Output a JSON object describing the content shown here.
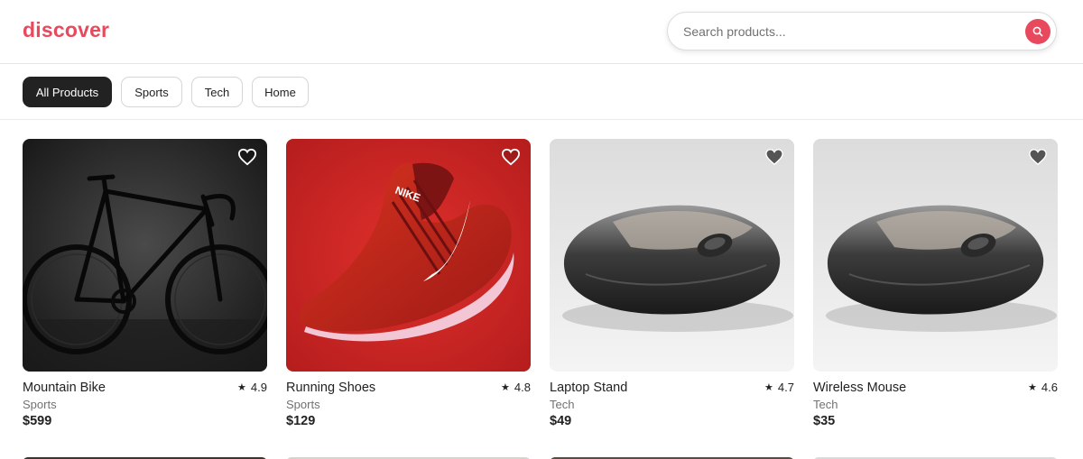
{
  "header": {
    "logo": "discover",
    "search_placeholder": "Search products..."
  },
  "filters": [
    {
      "label": "All Products",
      "active": true
    },
    {
      "label": "Sports",
      "active": false
    },
    {
      "label": "Tech",
      "active": false
    },
    {
      "label": "Home",
      "active": false
    }
  ],
  "products": [
    {
      "name": "Mountain Bike",
      "category": "Sports",
      "price": "$599",
      "rating": "4.9",
      "image": "bicycle",
      "favorite_icon": "heart-outline-icon"
    },
    {
      "name": "Running Shoes",
      "category": "Sports",
      "price": "$129",
      "rating": "4.8",
      "image": "red-nike-running-shoe",
      "favorite_icon": "heart-outline-icon"
    },
    {
      "name": "Laptop Stand",
      "category": "Tech",
      "price": "$49",
      "rating": "4.7",
      "image": "computer-mouse",
      "favorite_icon": "heart-filled-icon"
    },
    {
      "name": "Wireless Mouse",
      "category": "Tech",
      "price": "$35",
      "rating": "4.6",
      "image": "computer-mouse",
      "favorite_icon": "heart-filled-icon"
    }
  ],
  "colors": {
    "brand": "#e8495d",
    "active_chip": "#222222",
    "muted_text": "#717171"
  }
}
